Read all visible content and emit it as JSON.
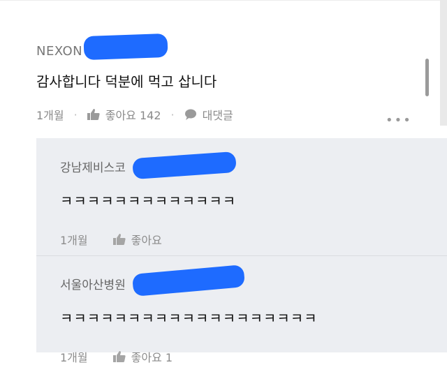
{
  "comment": {
    "author": "NEXON",
    "text": "감사합니다 덕분에 먹고 삽니다",
    "time": "1개월",
    "like_label": "좋아요 142",
    "reply_label": "대댓글",
    "more_icon": "more-dots-icon",
    "like_icon": "thumbs-up-icon",
    "reply_icon": "speech-bubble-icon"
  },
  "replies": [
    {
      "author": "강남제비스코",
      "text": "ㅋㅋㅋㅋㅋㅋㅋㅋㅋㅋㅋㅋㅋ",
      "time": "1개월",
      "like_label": "좋아요"
    },
    {
      "author": "서울아산병원",
      "text": "ㅋㅋㅋㅋㅋㅋㅋㅋㅋㅋㅋㅋㅋㅋㅋㅋㅋㅋㅋ",
      "time": "1개월",
      "like_label": "좋아요 1"
    }
  ],
  "colors": {
    "redaction": "#1e6bff",
    "reply_bg": "#eceef2",
    "meta_text": "#8a8a8a"
  }
}
